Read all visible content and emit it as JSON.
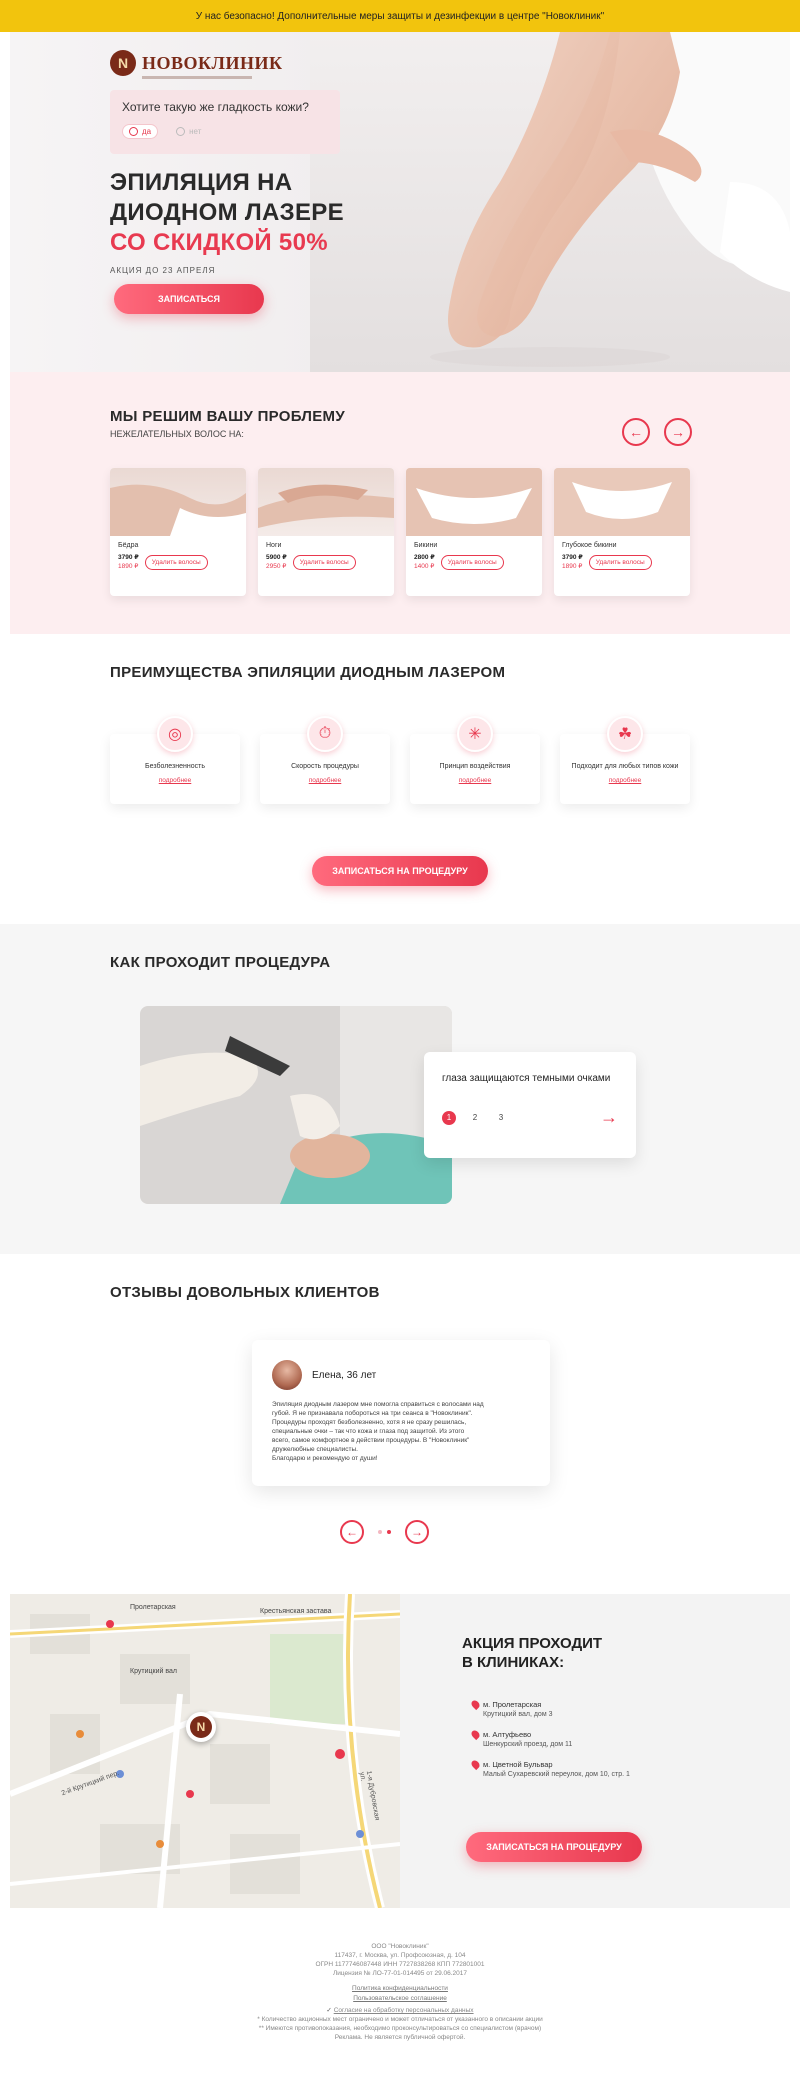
{
  "topbar": {
    "text": "У нас безопасно! Дополнительные меры защиты и дезинфекции в центре \"Новоклиник\""
  },
  "brand": {
    "logo_letter": "N",
    "name": "НОВОКЛИНИК"
  },
  "hero": {
    "quiz_question": "Хотите такую же гладкость кожи?",
    "quiz_options": [
      "да",
      "нет"
    ],
    "title_line1": "ЭПИЛЯЦИЯ НА",
    "title_line2": "ДИОДНОМ ЛАЗЕРЕ",
    "title_accent": "СО СКИДКОЙ 50%",
    "date_note": "АКЦИЯ ДО 23 АПРЕЛЯ",
    "cta": "ЗАПИСАТЬСЯ"
  },
  "problems": {
    "title": "МЫ РЕШИМ ВАШУ ПРОБЛЕМУ",
    "subtitle": "НЕЖЕЛАТЕЛЬНЫХ ВОЛОС НА:",
    "prev_icon": "arrow-left-icon",
    "next_icon": "arrow-right-icon",
    "cards": [
      {
        "name": "Бёдра",
        "price_new": "3790 ₽",
        "price_old": "1890 ₽",
        "button": "Удалить волосы"
      },
      {
        "name": "Ноги",
        "price_new": "5900 ₽",
        "price_old": "2950 ₽",
        "button": "Удалить волосы"
      },
      {
        "name": "Бикини",
        "price_new": "2800 ₽",
        "price_old": "1400 ₽",
        "button": "Удалить волосы"
      },
      {
        "name": "Глубокое бикини",
        "price_new": "3790 ₽",
        "price_old": "1890 ₽",
        "button": "Удалить волосы"
      }
    ]
  },
  "advantages": {
    "title": "ПРЕИМУЩЕСТВА ЭПИЛЯЦИИ ДИОДНЫМ ЛАЗЕРОМ",
    "items": [
      {
        "name": "Безболезненность",
        "more": "подробнее",
        "icon": "painless-icon"
      },
      {
        "name": "Скорость процедуры",
        "more": "подробнее",
        "icon": "stopwatch-icon"
      },
      {
        "name": "Принцип воздействия",
        "more": "подробнее",
        "icon": "laser-icon"
      },
      {
        "name": "Подходит для любых типов кожи",
        "more": "подробнее",
        "icon": "skin-icon"
      }
    ],
    "cta": "ЗАПИСАТЬСЯ НА ПРОЦЕДУРУ"
  },
  "procedure": {
    "title": "КАК ПРОХОДИТ ПРОЦЕДУРА",
    "step_text": "глаза защищаются темными очками",
    "steps": [
      "1",
      "2",
      "3"
    ],
    "active_step": 1
  },
  "reviews": {
    "title": "ОТЗЫВЫ ДОВОЛЬНЫХ КЛИЕНТОВ",
    "author": "Елена, 36 лет",
    "text_lines": [
      "Эпиляция диодным лазером мне помогла справиться с волосами над",
      "губой. Я не признавала побороться на три сеанса в \"Новоклиник\".",
      "Процедуры проходят безболезненно, хотя я не сразу решилась,",
      "специальные очки – так что кожа и глаза под защитой. Из этого",
      "всего, самое комфортное в действии процедуры. В \"Новоклиник\"",
      "дружелюбные специалисты.",
      "Благодарю и рекомендую от души!"
    ],
    "dots": 2,
    "active_dot": 2
  },
  "clinics": {
    "title_line1": "АКЦИЯ ПРОХОДИТ",
    "title_line2": "В КЛИНИКАХ:",
    "addresses": [
      {
        "metro": "м. Пролетарская",
        "street": "Крутицкий вал, дом 3"
      },
      {
        "metro": "м. Алтуфьево",
        "street": "Шенкурский проезд, дом 11"
      },
      {
        "metro": "м. Цветной Бульвар",
        "street": "Малый Сухаревский переулок, дом 10, стр. 1"
      }
    ],
    "cta": "ЗАПИСАТЬСЯ НА ПРОЦЕДУРУ",
    "map_labels": {
      "proletarskaya": "Пролетарская",
      "krestyanskaya": "Крестьянская застава",
      "krutitsky": "Крутицкий вал",
      "street_label": "2-й Крутицкий пер.",
      "dubrovskaya": "1-я Дубровская ул."
    }
  },
  "footer": {
    "lines": [
      "ООО \"Новоклиник\"",
      "117437, г. Москва, ул. Профсоюзная, д. 104",
      "ОГРН 1177746087448 ИНН 7727838268 КПП 772801001",
      "Лицензия № ЛО-77-01-014495 от 29.06.2017"
    ],
    "links": [
      "Политика конфиденциальности",
      "Пользовательское соглашение"
    ],
    "consent": "Согласие на обработку персональных данных",
    "notes": [
      "* Количество акционных мест ограничено и может отличаться от указанного в описании акции",
      "** Имеются противопоказания, необходимо проконсультироваться со специалистом (врачом)",
      "Реклама. Не является публичной офертой."
    ]
  },
  "colors": {
    "accent": "#e8384e",
    "banner": "#f2c40d",
    "pink_bg": "#fdeef0",
    "brand": "#7a2a18"
  }
}
